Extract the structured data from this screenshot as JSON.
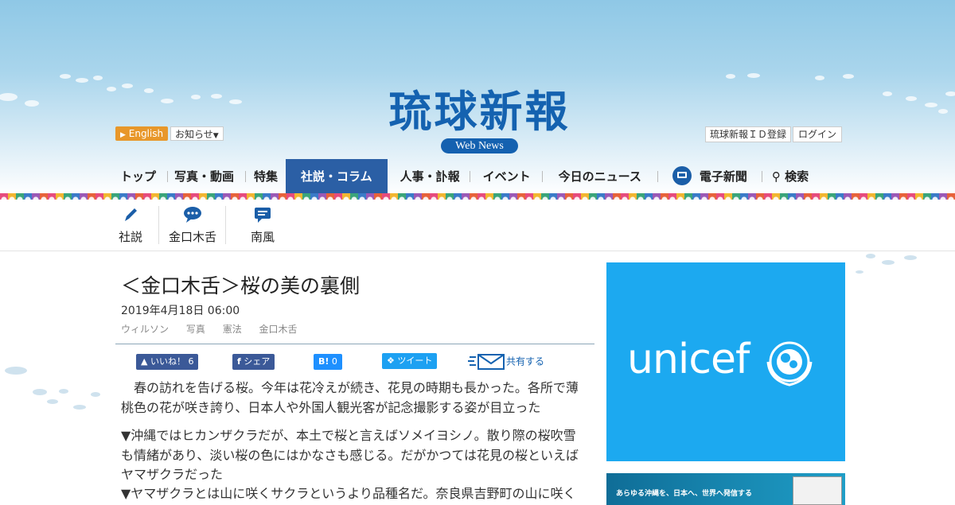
{
  "header": {
    "logo_title": "琉球新報",
    "logo_badge": "Web News",
    "english_label": "English",
    "notice_label": "お知らせ",
    "id_register_label": "琉球新報ＩＤ登録",
    "login_label": "ログイン"
  },
  "nav": {
    "items": [
      "トップ",
      "写真・動画",
      "特集",
      "社説・コラム",
      "人事・訃報",
      "イベント",
      "今日のニュース",
      "電子新聞",
      "検索"
    ],
    "active_index": 3,
    "active_color": "#2b5fa5"
  },
  "subnav": {
    "items": [
      {
        "label": "社説",
        "icon": "pen-icon"
      },
      {
        "label": "金口木舌",
        "icon": "speech-bubble-icon"
      },
      {
        "label": "南風",
        "icon": "chat-icon"
      }
    ]
  },
  "article": {
    "title": "＜金口木舌＞桜の美の裏側",
    "date": "2019年4月18日 06:00",
    "tags": [
      "ウィルソン",
      "写真",
      "憲法",
      "金口木舌"
    ],
    "share": {
      "like_label": "いいね！",
      "like_count": "6",
      "share_label": "シェア",
      "hatena_label": "B!",
      "hatena_count": "0",
      "tweet_label": "ツイート",
      "kyoyu_label": "共有する"
    },
    "paragraphs": [
      "　春の訪れを告げる桜。今年は花冷えが続き、花見の時期も長かった。各所で薄桃色の花が咲き誇り、日本人や外国人観光客が記念撮影する姿が目立った",
      "▼沖縄ではヒカンザクラだが、本土で桜と言えばソメイヨシノ。散り際の桜吹雪も情緒があり、淡い桜の色にはかなさも感じる。だがかつては花見の桜といえばヤマザクラだった",
      "▼ヤマザクラとは山に咲くサクラというより品種名だ。奈良県吉野町の山に咲く"
    ]
  },
  "ads": {
    "unicef_text": "unicef",
    "unicef_color": "#1ca9f0",
    "banner_text": "あらゆる沖縄を、日本へ、世界へ発信する"
  }
}
